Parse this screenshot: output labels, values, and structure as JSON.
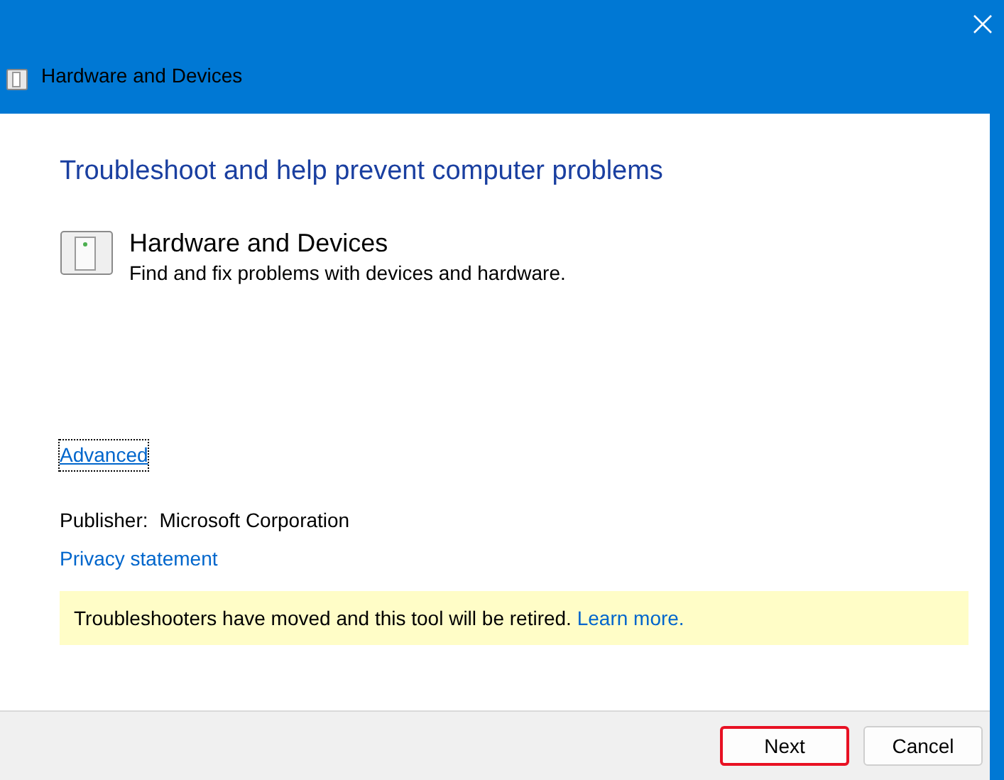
{
  "window": {
    "title": "Hardware and Devices"
  },
  "heading": "Troubleshoot and help prevent computer problems",
  "troubleshooter": {
    "title": "Hardware and Devices",
    "description": "Find and fix problems with devices and hardware."
  },
  "advanced_link": {
    "label": "Advanced",
    "focused": true
  },
  "publisher": {
    "label": "Publisher:",
    "value": "Microsoft Corporation"
  },
  "privacy_link": "Privacy statement",
  "notice": {
    "text": "Troubleshooters have moved and this tool will be retired.",
    "link": "Learn more."
  },
  "buttons": [
    {
      "label": "Next",
      "highlighted": true
    },
    {
      "label": "Cancel",
      "highlighted": false
    }
  ]
}
